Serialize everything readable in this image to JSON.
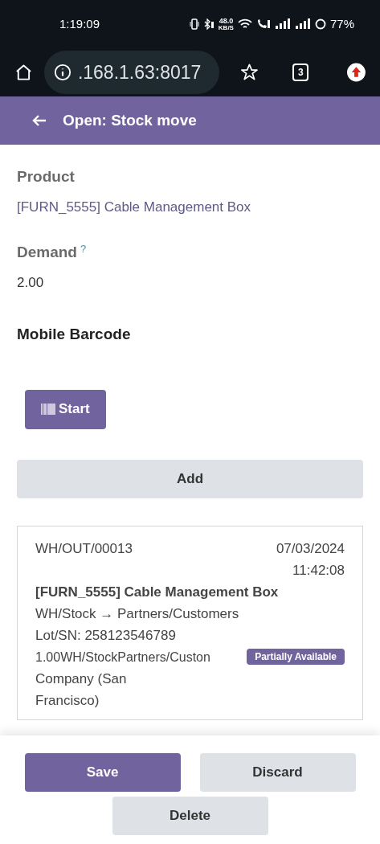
{
  "status_bar": {
    "time": "1:19:09",
    "speed": "48.0",
    "speed_unit": "KB/S",
    "battery": "77%"
  },
  "browser": {
    "url": ".168.1.63:8017",
    "tab_count": "3"
  },
  "header": {
    "title": "Open: Stock move"
  },
  "fields": [
    {
      "label": "Product",
      "value": "[FURN_5555] Cable Management Box",
      "kind": "link"
    },
    {
      "label": "Demand",
      "help": "?",
      "value": "2.00",
      "kind": "plain"
    }
  ],
  "section": {
    "title": "Mobile Barcode",
    "start_button": "Start"
  },
  "add_button": "Add",
  "move_card": {
    "reference": "WH/OUT/00013",
    "date": "07/03/2024",
    "time": "11:42:08",
    "product": "[FURN_5555] Cable Management Box",
    "route": "WH/Stock → Partners/Customers",
    "lot": "Lot/SN: 258123546789",
    "line": "1.00WH/StockPartners/Custon",
    "badge": "Partially Available",
    "company": "Company (San Francisco)"
  },
  "footer": {
    "save": "Save",
    "discard": "Discard",
    "delete": "Delete"
  }
}
